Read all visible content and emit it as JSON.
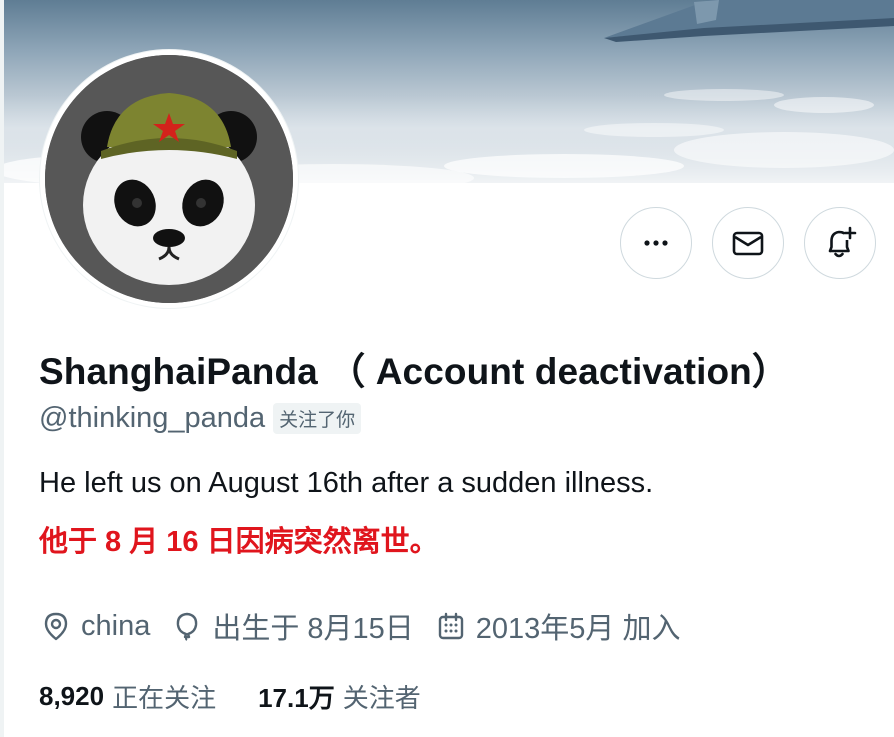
{
  "profile": {
    "display_name": "ShanghaiPanda （ Account deactivation）",
    "handle": "@thinking_panda",
    "follows_you_badge": "关注了你",
    "bio_line1": "He left us on August 16th after a sudden illness.",
    "bio_line2": "他于 8 月 16 日因病突然离世。",
    "bio_line2_color": "#e0151d",
    "location": "china",
    "birthday": "出生于 8月15日",
    "joined": "2013年5月 加入"
  },
  "actions": {
    "more_icon": "more-horizontal-icon",
    "message_icon": "envelope-icon",
    "notify_icon": "bell-plus-icon"
  },
  "stats": {
    "following_count": "8,920",
    "following_label": "正在关注",
    "followers_count": "17.1万",
    "followers_label": "关注者"
  },
  "colors": {
    "text_primary": "#0f1419",
    "text_secondary": "#536471",
    "border": "#cfd9de",
    "accent_red": "#e0151d"
  }
}
